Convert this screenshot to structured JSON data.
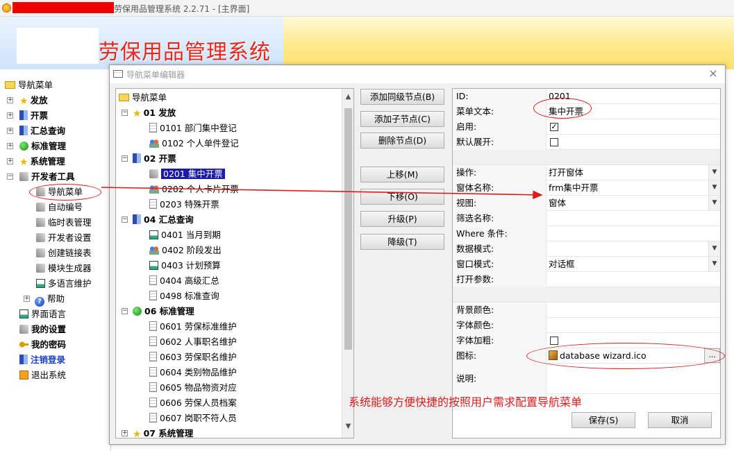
{
  "window": {
    "title_suffix": "劳保用品管理系统 2.2.71 - [主界面]",
    "app_title": "劳保用品管理系统"
  },
  "nav_tree": {
    "root": "导航菜单",
    "items": [
      {
        "label": "发放",
        "bold": true,
        "icon": "star-icon"
      },
      {
        "label": "开票",
        "bold": true,
        "icon": "card-icon"
      },
      {
        "label": "汇总查询",
        "bold": true,
        "icon": "report-icon"
      },
      {
        "label": "标准管理",
        "bold": true,
        "icon": "globe-icon"
      },
      {
        "label": "系统管理",
        "bold": true,
        "icon": "star-icon"
      },
      {
        "label": "开发者工具",
        "bold": true,
        "icon": "tools-icon"
      }
    ],
    "dev_children": [
      "导航菜单",
      "自动编号",
      "临时表管理",
      "开发者设置",
      "创建链接表",
      "模块生成器",
      "多语言维护"
    ],
    "help": "帮助",
    "bottom_items": [
      "界面语言",
      "我的设置",
      "我的密码",
      "注销登录",
      "退出系统"
    ]
  },
  "dialog": {
    "title": "导航菜单编辑器",
    "close": "×",
    "tree": {
      "root": "导航菜单",
      "groups": [
        {
          "label": "01 发放",
          "children": [
            "0101 部门集中登记",
            "0102 个人单件登记"
          ]
        },
        {
          "label": "02 开票",
          "children": [
            "0201 集中开票",
            "0202 个人卡片开票",
            "0203 特殊开票"
          ]
        },
        {
          "label": "04 汇总查询",
          "children": [
            "0401 当月到期",
            "0402 阶段发出",
            "0403 计划预算",
            "0404 高级汇总",
            "0498 标准查询"
          ]
        },
        {
          "label": "06 标准管理",
          "children": [
            "0601 劳保标准维护",
            "0602 人事职名维护",
            "0603 劳保职名维护",
            "0604 类别物品维护",
            "0605 物品物资对应",
            "0606 劳保人员档案",
            "0607 岗职不符人员"
          ]
        },
        {
          "label": "07 系统管理",
          "children": []
        }
      ]
    },
    "buttons": {
      "add_sibling": "添加同级节点(B)",
      "add_child": "添加子节点(C)",
      "delete": "删除节点(D)",
      "move_up": "上移(M)",
      "move_down": "下移(O)",
      "promote": "升级(P)",
      "demote": "降级(T)",
      "save": "保存(S)",
      "cancel": "取消"
    },
    "props": {
      "id_label": "ID:",
      "id_value": "0201",
      "text_label": "菜单文本:",
      "text_value": "集中开票",
      "enabled_label": "启用:",
      "enabled_check": "✓",
      "expand_label": "默认展开:",
      "op_label": "操作:",
      "op_value": "打开窗体",
      "form_label": "窗体名称:",
      "form_value": "frm集中开票",
      "view_label": "视图:",
      "view_value": "窗体",
      "filter_label": "筛选名称:",
      "where_label": "Where 条件:",
      "datamode_label": "数据模式:",
      "winmode_label": "窗口模式:",
      "winmode_value": "对话框",
      "openarg_label": "打开参数:",
      "bg_label": "背景颜色:",
      "fontcolor_label": "字体颜色:",
      "bold_label": "字体加粗:",
      "icon_label": "图标:",
      "icon_value": "database wizard.ico",
      "browse": "...",
      "desc_label": "说明:"
    }
  },
  "annotation": {
    "caption": "系统能够方便快捷的按照用户需求配置导航菜单",
    "color": "#e01a1a"
  }
}
